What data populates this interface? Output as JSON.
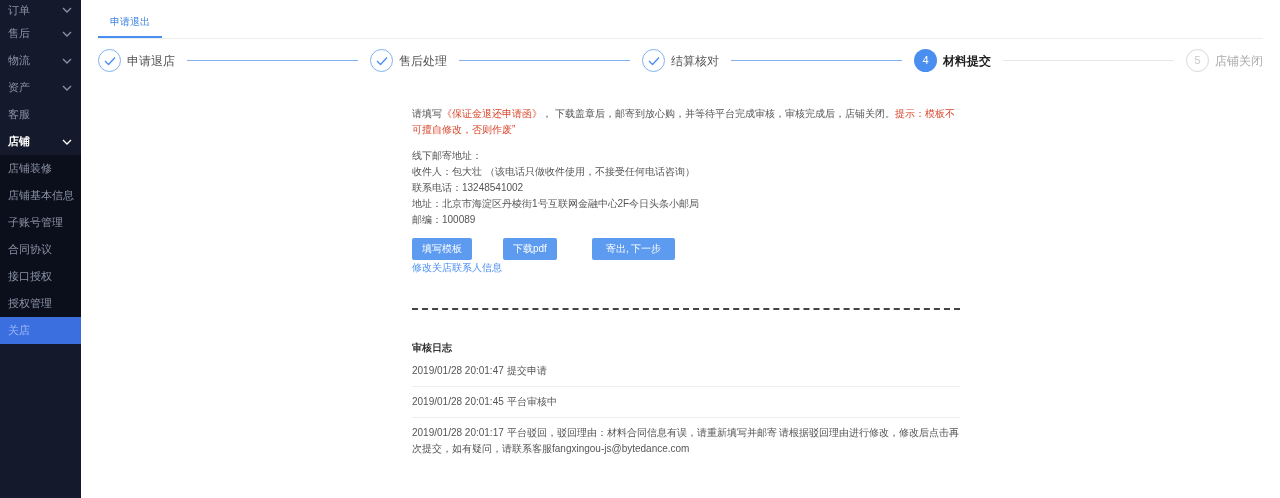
{
  "sidebar": {
    "items": [
      {
        "label": "订单",
        "expanded": false,
        "selected": false
      },
      {
        "label": "售后",
        "expanded": false,
        "selected": false
      },
      {
        "label": "物流",
        "expanded": false,
        "selected": false
      },
      {
        "label": "资产",
        "expanded": false,
        "selected": false
      },
      {
        "label": "客服",
        "selected": false
      },
      {
        "label": "店铺",
        "expanded": true,
        "selected": false,
        "children": [
          {
            "label": "店铺装修",
            "selected": false
          },
          {
            "label": "店铺基本信息",
            "selected": false
          },
          {
            "label": "子账号管理",
            "selected": false
          },
          {
            "label": "合同协议",
            "selected": false
          },
          {
            "label": "接口授权",
            "selected": false
          },
          {
            "label": "授权管理",
            "selected": false
          },
          {
            "label": "关店",
            "selected": true
          }
        ]
      }
    ]
  },
  "tabs": [
    {
      "label": "申请退出",
      "selected": true
    }
  ],
  "steps": [
    {
      "label": "申请退店",
      "completed": true,
      "selected": false
    },
    {
      "label": "售后处理",
      "completed": true,
      "selected": false
    },
    {
      "label": "结算核对",
      "completed": true,
      "selected": false
    },
    {
      "label": "材料提交",
      "completed": false,
      "selected": true,
      "number": "4"
    },
    {
      "label": "店铺关闭",
      "completed": false,
      "selected": false,
      "number": "5"
    }
  ],
  "instruction": [
    {
      "text": "请填写",
      "highlight": false
    },
    {
      "text": "《保证金退还申请函》",
      "highlight": true
    },
    {
      "text": "，  下载盖章后，邮寄到放心购，并等待平台完成审核，审核完成后，店铺关闭。",
      "highlight": false
    },
    {
      "text": "提示：模板不可擅自修改，否则作废”",
      "highlight": true
    }
  ],
  "address_lines": [
    "线下邮寄地址：",
    "收件人：包大壮 （该电话只做收件使用，不接受任何电话咨询）",
    "联系电话：13248541002",
    "地址：北京市海淀区丹棱街1号互联网金融中心2F今日头条小邮局",
    "邮编：100089"
  ],
  "buttons": [
    "填写模板",
    "下载pdf",
    "寄出, 下一步"
  ],
  "edit_link": "修改关店联系人信息",
  "log": {
    "title": "审核日志",
    "entries": [
      "2019/01/28 20:01:47 提交申请",
      "2019/01/28 20:01:45 平台审核中",
      "2019/01/28 20:01:17 平台驳回，驳回理由：材料合同信息有误，请重新填写并邮寄 请根据驳回理由进行修改，修改后点击再次提交，如有疑问，请联系客服fangxingou-js@bytedance.com"
    ]
  }
}
